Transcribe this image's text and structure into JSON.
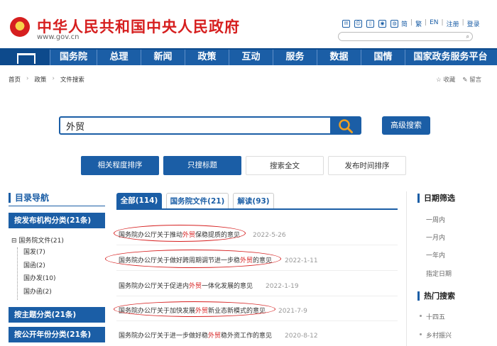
{
  "header": {
    "site_title": "中华人民共和国中央人民政府",
    "site_url": "www.gov.cn",
    "icons": [
      "mail-icon",
      "chat-icon",
      "mobile-icon",
      "weibo-icon",
      "wechat-icon"
    ],
    "links": [
      "简",
      "繁",
      "EN",
      "注册",
      "登录"
    ],
    "search_icon": "search-icon"
  },
  "nav": {
    "items": [
      "国务院",
      "总理",
      "新闻",
      "政策",
      "互动",
      "服务",
      "数据",
      "国情",
      "国家政务服务平台"
    ]
  },
  "breadcrumb": [
    "首页",
    "政策",
    "文件搜索"
  ],
  "tools": [
    "收藏",
    "留言"
  ],
  "search": {
    "value": "外贸",
    "advanced_label": "高级搜索"
  },
  "filters": [
    "相关程度排序",
    "只搜标题",
    "搜索全文",
    "发布时间排序"
  ],
  "sidebar": {
    "title": "目录导航",
    "sections": [
      "按发布机构分类(21条)",
      "按主题分类(21条)",
      "按公开年份分类(21条)"
    ],
    "tree_root": "国务院文件(21)",
    "tree_children": [
      "国发(7)",
      "国函(2)",
      "国办发(10)",
      "国办函(2)"
    ]
  },
  "tabs": [
    "全部(114)",
    "国务院文件(21)",
    "解读(93)"
  ],
  "results": [
    {
      "before": "国务院办公厅关于推动",
      "hl": "外贸",
      "after": "保稳提质的意见",
      "date": "2022-5-26"
    },
    {
      "before": "国务院办公厅关于做好跨周期调节进一步稳",
      "hl": "外贸",
      "after": "的意见",
      "date": "2022-1-11"
    },
    {
      "before": "国务院办公厅关于促进内",
      "hl": "外贸",
      "after": "一体化发展的意见",
      "date": "2022-1-19"
    },
    {
      "before": "国务院办公厅关于加快发展",
      "hl": "外贸",
      "after": "新业态新模式的意见",
      "date": "2021-7-9"
    },
    {
      "before": "国务院办公厅关于进一步做好稳",
      "hl": "外贸",
      "after": "稳外资工作的意见",
      "date": "2020-8-12"
    }
  ],
  "right": {
    "date_title": "日期筛选",
    "date_items": [
      "一周内",
      "一月内",
      "一年内",
      "指定日期"
    ],
    "hot_title": "热门搜索",
    "hot_items": [
      "十四五",
      "乡村振兴"
    ]
  }
}
